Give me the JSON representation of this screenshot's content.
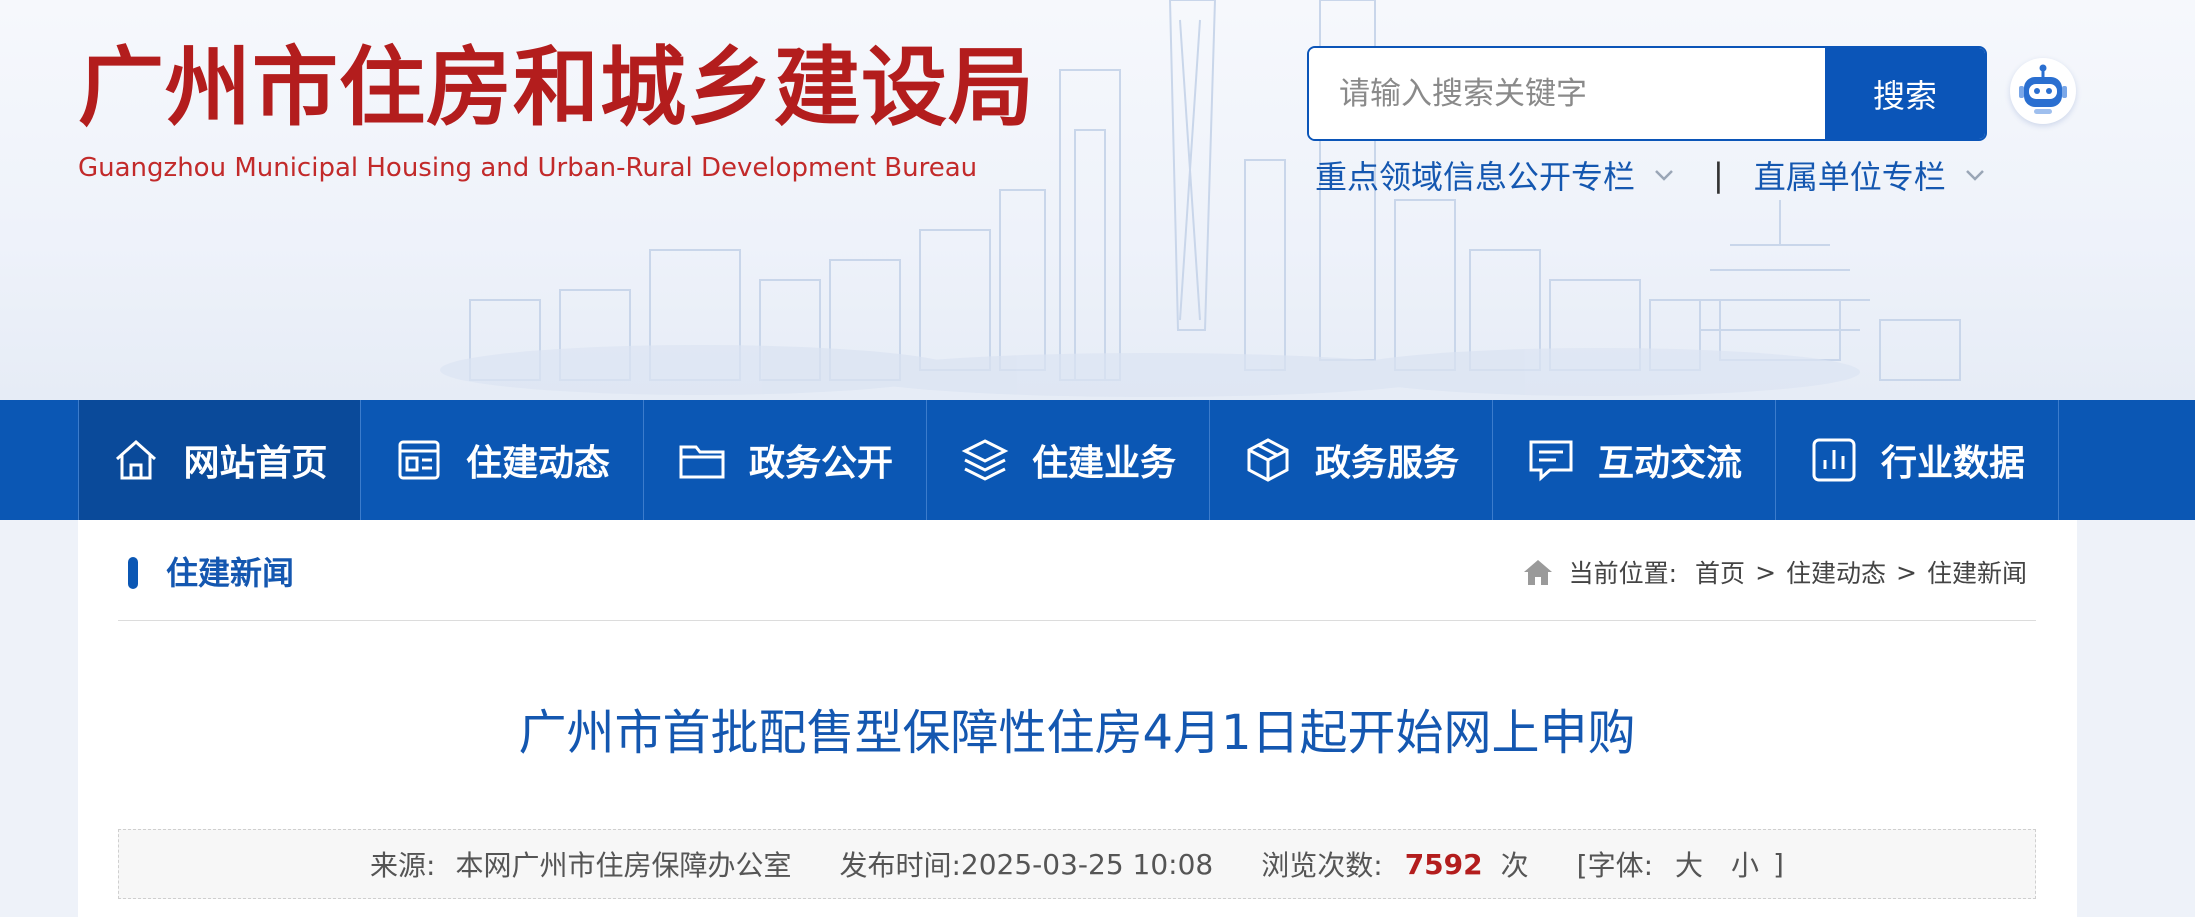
{
  "header": {
    "title": "广州市住房和城乡建设局",
    "subtitle": "Guangzhou Municipal Housing and Urban-Rural Development Bureau"
  },
  "search": {
    "placeholder": "请输入搜索关键字",
    "button_label": "搜索"
  },
  "quick_links": [
    {
      "label": "重点领域信息公开专栏"
    },
    {
      "label": "直属单位专栏"
    }
  ],
  "quick_sep": "|",
  "nav": {
    "items": [
      {
        "label": "网站首页",
        "icon": "home-icon"
      },
      {
        "label": "住建动态",
        "icon": "news-icon"
      },
      {
        "label": "政务公开",
        "icon": "folder-icon"
      },
      {
        "label": "住建业务",
        "icon": "layers-icon"
      },
      {
        "label": "政务服务",
        "icon": "cube-icon"
      },
      {
        "label": "互动交流",
        "icon": "chat-icon"
      },
      {
        "label": "行业数据",
        "icon": "chart-icon"
      }
    ],
    "active_index": 0
  },
  "section": {
    "title": "住建新闻"
  },
  "breadcrumb": {
    "label": "当前位置:",
    "items": [
      "首页",
      "住建动态",
      "住建新闻"
    ],
    "separator": ">"
  },
  "article": {
    "title": "广州市首批配售型保障性住房4月1日起开始网上申购",
    "source_label": "来源:",
    "source": "本网广州市住房保障办公室",
    "time_label": "发布时间:",
    "time": "2025-03-25 10:08",
    "views_label": "浏览次数:",
    "views": "7592",
    "views_unit": "次",
    "font_open": "[字体:",
    "font_large": "大",
    "font_small": "小",
    "font_close": "]"
  },
  "colors": {
    "brand_red": "#b31d1d",
    "nav_blue": "#0b57b4",
    "link_blue": "#1457b0"
  }
}
